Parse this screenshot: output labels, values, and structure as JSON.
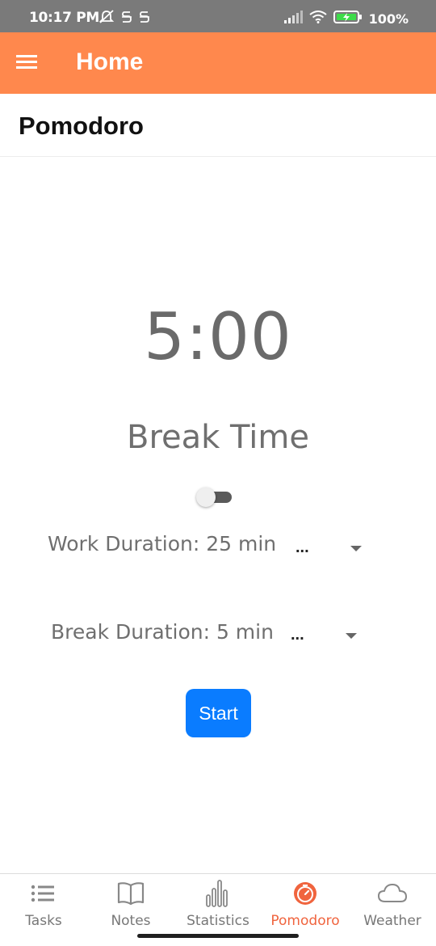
{
  "status_bar": {
    "time": "10:17 PM",
    "battery": "100%",
    "icons": [
      "bell-off-icon",
      "s-app-icon",
      "s-app-icon",
      "signal-icon",
      "wifi-icon",
      "battery-icon"
    ]
  },
  "app_bar": {
    "title": "Home",
    "background": "#ff884d",
    "menu_icon": "hamburger-menu-icon"
  },
  "screen": {
    "title": "Pomodoro"
  },
  "timer": {
    "display": "5:00",
    "mode_label": "Break Time",
    "mode_toggle_on": false
  },
  "work_duration": {
    "label": "Work Duration: 25 min",
    "selected": "..."
  },
  "break_duration": {
    "label": "Break Duration: 5 min",
    "selected": "..."
  },
  "start_button": {
    "label": "Start",
    "color": "#0a7cff"
  },
  "bottom_nav": {
    "active_color": "#f0643e",
    "items": [
      {
        "label": "Tasks",
        "icon": "list-icon",
        "active": false
      },
      {
        "label": "Notes",
        "icon": "book-icon",
        "active": false
      },
      {
        "label": "Statistics",
        "icon": "bar-chart-icon",
        "active": false
      },
      {
        "label": "Pomodoro",
        "icon": "timer-icon",
        "active": true
      },
      {
        "label": "Weather",
        "icon": "cloud-icon",
        "active": false
      }
    ]
  }
}
